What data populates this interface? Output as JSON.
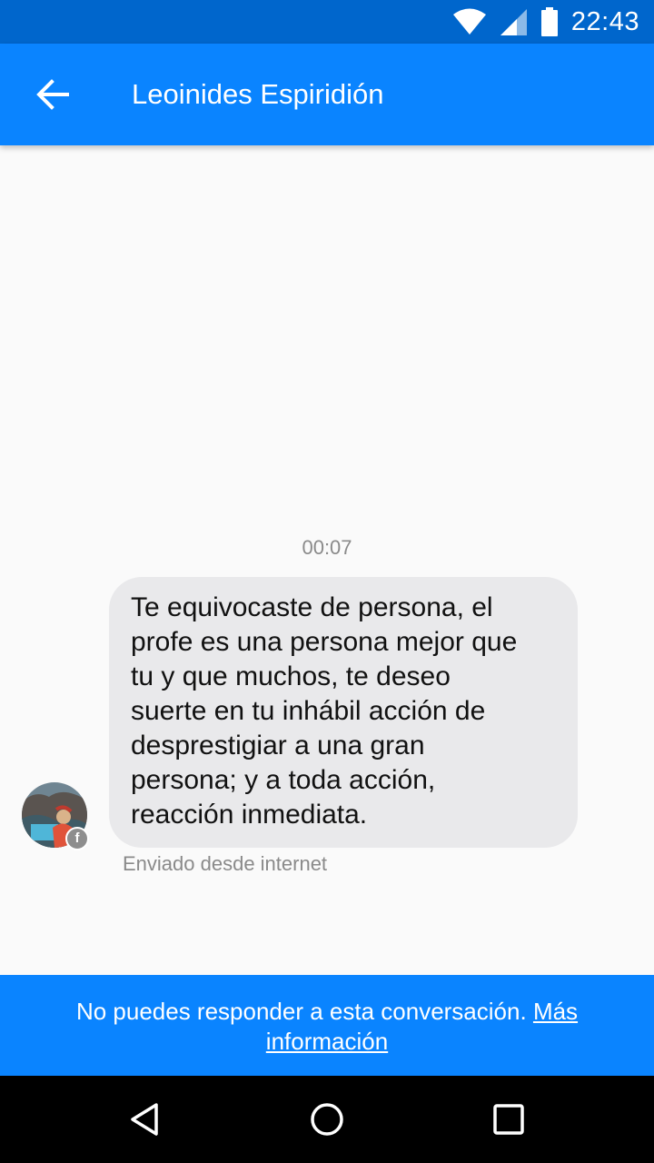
{
  "status_bar": {
    "time": "22:43",
    "icons": [
      "wifi-icon",
      "cell-signal-icon",
      "battery-icon"
    ]
  },
  "header": {
    "back_icon": "arrow-left-icon",
    "title": "Leoinides Espiridión"
  },
  "conversation": {
    "timestamp": "00:07",
    "message": {
      "text": "Te equivocaste de persona, el\nprofe es una persona mejor que\ntu y que muchos, te deseo\nsuerte en tu inhábil acción de\ndesprestigiar a una gran\npersona; y a toda acción,\nreacción inmediata.",
      "sent_via": "Enviado desde internet"
    },
    "sender_avatar_badge": "facebook-icon"
  },
  "footer_notice": {
    "text": "No puedes responder a esta conversación.",
    "link_text": "Más información"
  },
  "nav_bar": {
    "icons": [
      "back-triangle-icon",
      "home-circle-icon",
      "recents-square-icon"
    ]
  },
  "colors": {
    "status_bar": "#0066cc",
    "app_bar": "#0a84ff",
    "bubble": "#e9e9eb",
    "background": "#fafafa"
  }
}
